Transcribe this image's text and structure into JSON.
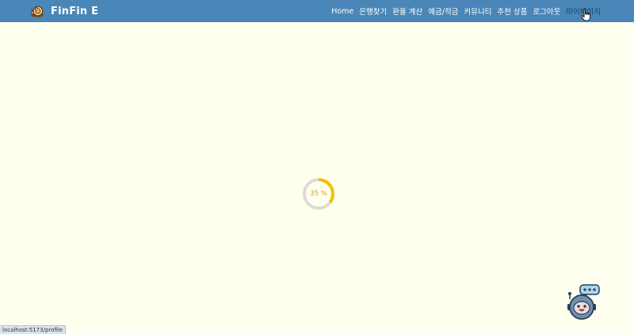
{
  "navbar": {
    "brand": "FinFin E",
    "links": [
      "Home",
      "은행찾기",
      "환율 계산",
      "예금/적금",
      "커뮤니티",
      "추천 상품",
      "로그아웃",
      "마이페이지"
    ],
    "active_index": 7,
    "background": "#4a86b7"
  },
  "loader": {
    "progress_percent": 35,
    "label": "35 %",
    "color": "#f5c000",
    "track_color": "#dcdcd0"
  },
  "chatbot": {
    "icon": "robot-chatbot-icon"
  },
  "status_bar": {
    "url": "localhost:5173/profile"
  },
  "colors": {
    "page_background": "#fffff0"
  }
}
